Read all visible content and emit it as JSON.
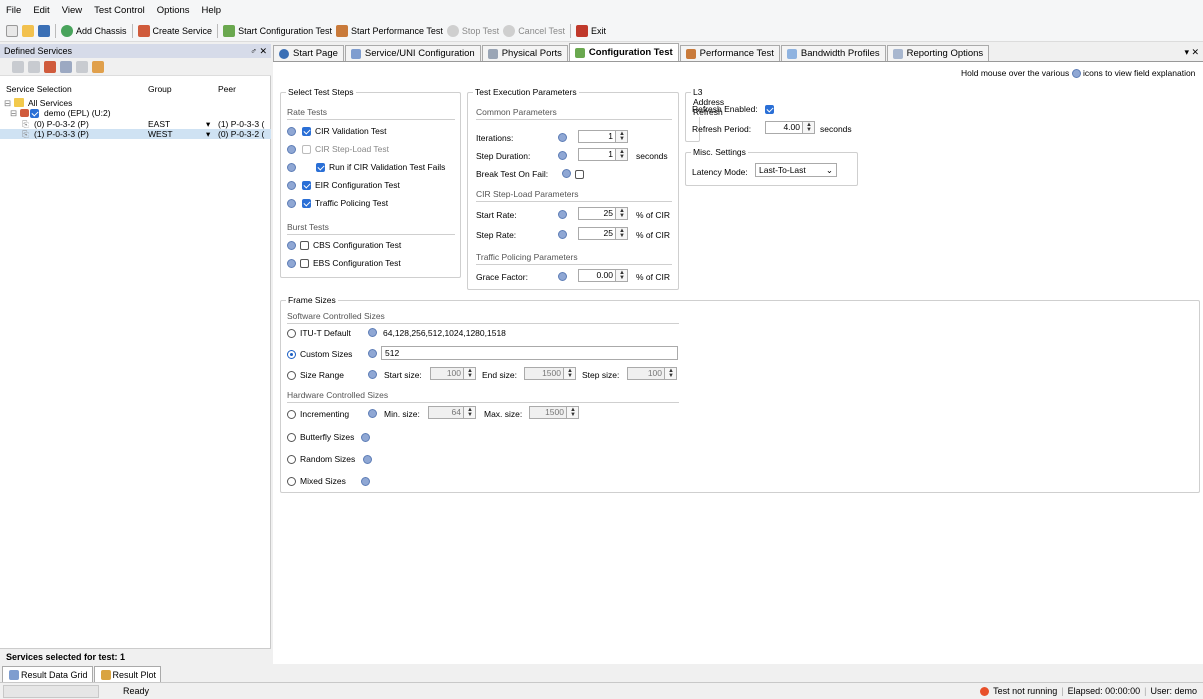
{
  "menu": [
    "File",
    "Edit",
    "View",
    "Test Control",
    "Options",
    "Help"
  ],
  "toolbar": {
    "add_chassis": "Add Chassis",
    "create_service": "Create Service",
    "start_config": "Start Configuration Test",
    "start_perf": "Start Performance Test",
    "stop": "Stop Test",
    "cancel": "Cancel Test",
    "exit": "Exit"
  },
  "left": {
    "title": "Defined Services",
    "pin": "♂ ✕",
    "headers": [
      "Service Selection",
      "Group",
      "Peer"
    ],
    "tree": {
      "all": "All Services",
      "demo": "demo (EPL) (U:2)",
      "rows": [
        {
          "name": "(0) P-0-3-2 (P)",
          "group": "EAST",
          "peer": "(1) P-0-3-3 ("
        },
        {
          "name": "(1) P-0-3-3 (P)",
          "group": "WEST",
          "peer": "(0) P-0-3-2 ("
        }
      ]
    },
    "selected_count": "Services selected for test: 1"
  },
  "tabs": [
    "Start Page",
    "Service/UNI Configuration",
    "Physical Ports",
    "Configuration Test",
    "Performance Test",
    "Bandwidth Profiles",
    "Reporting Options"
  ],
  "tabs_close": "▾ ✕",
  "hint": "Hold mouse over the various",
  "hint2": "icons to view field explanation",
  "select_steps": {
    "title": "Select Test Steps",
    "rate_tests": "Rate Tests",
    "cir_validation": "CIR Validation Test",
    "cir_step_load": "CIR Step-Load Test",
    "run_if": "Run if CIR Validation Test Fails",
    "eir": "EIR Configuration Test",
    "policing": "Traffic Policing Test",
    "burst_tests": "Burst Tests",
    "cbs": "CBS Configuration Test",
    "ebs": "EBS Configuration Test"
  },
  "exec": {
    "title": "Test Execution Parameters",
    "common": "Common Parameters",
    "iterations_label": "Iterations:",
    "iterations": "1",
    "step_dur_label": "Step Duration:",
    "step_dur": "1",
    "seconds": "seconds",
    "break_label": "Break Test On Fail:",
    "cir_params": "CIR Step-Load Parameters",
    "start_rate_label": "Start Rate:",
    "start_rate": "25",
    "step_rate_label": "Step Rate:",
    "step_rate": "25",
    "pct_cir": "% of CIR",
    "policing_params": "Traffic Policing Parameters",
    "grace_label": "Grace Factor:",
    "grace": "0.00"
  },
  "l3": {
    "title": "L3 Address Refresh",
    "enabled_label": "Refresh Enabled:",
    "period_label": "Refresh Period:",
    "period": "4.00",
    "seconds": "seconds"
  },
  "misc": {
    "title": "Misc. Settings",
    "latency_label": "Latency Mode:",
    "latency": "Last-To-Last"
  },
  "frames": {
    "title": "Frame Sizes",
    "software": "Software Controlled Sizes",
    "itu": "ITU-T Default",
    "itu_values": "64,128,256,512,1024,1280,1518",
    "custom": "Custom Sizes",
    "custom_value": "512",
    "range": "Size Range",
    "start_size_label": "Start size:",
    "start_size": "100",
    "end_size_label": "End size:",
    "end_size": "1500",
    "step_size_label": "Step size:",
    "step_size": "100",
    "hardware": "Hardware Controlled Sizes",
    "incrementing": "Incrementing",
    "min_label": "Min. size:",
    "min": "64",
    "max_label": "Max. size:",
    "max": "1500",
    "butterfly": "Butterfly Sizes",
    "random": "Random Sizes",
    "mixed": "Mixed Sizes"
  },
  "bottom_tabs": [
    "Result Data Grid",
    "Result Plot"
  ],
  "status": {
    "ready": "Ready",
    "test_state": "Test not running",
    "elapsed": "Elapsed: 00:00:00",
    "user": "User: demo"
  },
  "colors": {
    "accent": "#2a6fd6",
    "panel_title": "#d6dbe9",
    "selection": "#cfe2f3",
    "status_dot": "#e8502a"
  }
}
